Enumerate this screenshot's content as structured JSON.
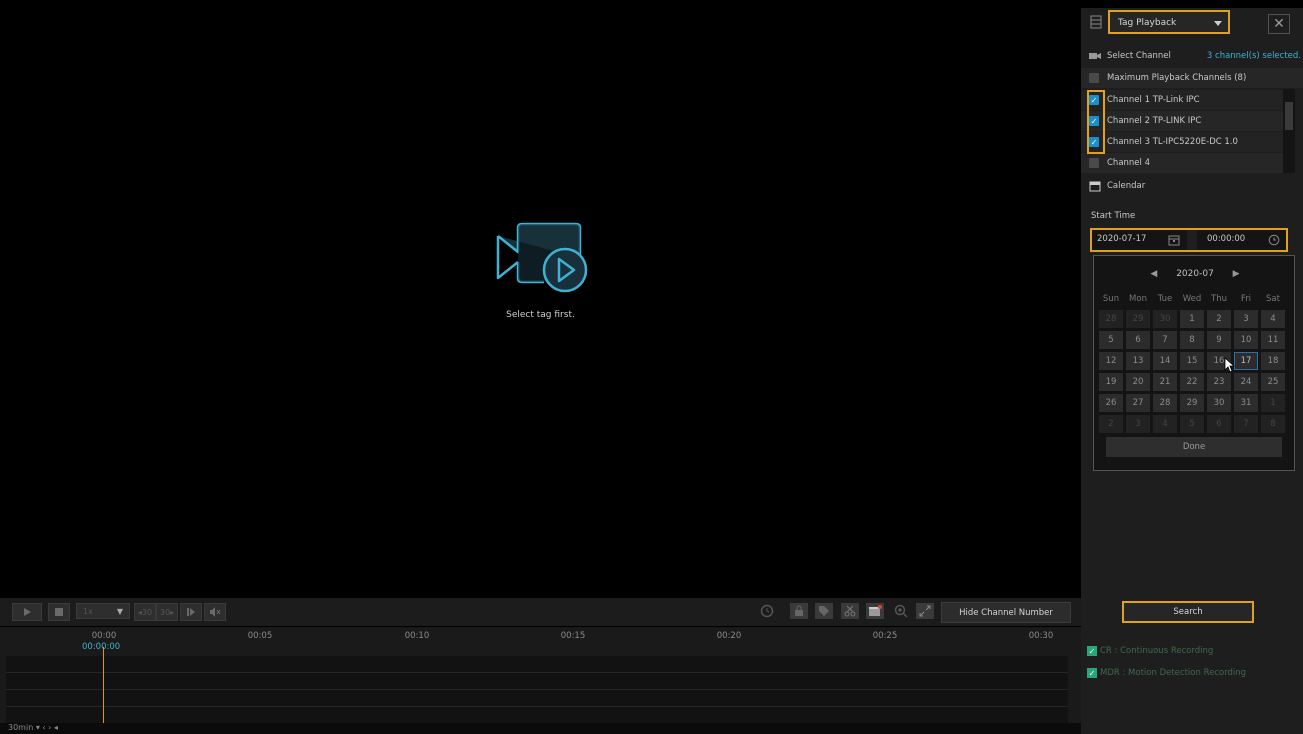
{
  "video": {
    "message": "Select tag first."
  },
  "toolbar": {
    "speed": "1x",
    "rewind": "◂30",
    "forward": "30▸",
    "hide_channel_label": "Hide Channel Number"
  },
  "timeline": {
    "ticks": [
      "00:00",
      "00:05",
      "00:10",
      "00:15",
      "00:20",
      "00:25",
      "00:30"
    ],
    "cursor_time": "00:00:00",
    "zoom": "30min"
  },
  "panel": {
    "mode": "Tag Playback",
    "select_channel_label": "Select Channel",
    "selected_summary": "3 channel(s) selected.",
    "max_channels": "Maximum Playback Channels (8)",
    "channels": [
      {
        "label": "Channel 1 TP-Link IPC",
        "checked": true
      },
      {
        "label": "Channel 2 TP-LINK IPC",
        "checked": true
      },
      {
        "label": "Channel 3 TL-IPC5220E-DC 1.0",
        "checked": true
      },
      {
        "label": "Channel 4",
        "checked": false
      }
    ],
    "calendar_label": "Calendar",
    "start_time_label": "Start Time",
    "date": "2020-07-17",
    "time": "00:00:00",
    "search_label": "Search",
    "legend": [
      {
        "label": "CR : Continuous Recording",
        "color": "#27a87a"
      },
      {
        "label": "MDR : Motion Detection Recording",
        "color": "#27a87a"
      }
    ]
  },
  "calendar": {
    "month": "2020-07",
    "weekdays": [
      "Sun",
      "Mon",
      "Tue",
      "Wed",
      "Thu",
      "Fri",
      "Sat"
    ],
    "weeks": [
      [
        "28",
        "29",
        "30",
        "1",
        "2",
        "3",
        "4"
      ],
      [
        "5",
        "6",
        "7",
        "8",
        "9",
        "10",
        "11"
      ],
      [
        "12",
        "13",
        "14",
        "15",
        "16",
        "17",
        "18"
      ],
      [
        "19",
        "20",
        "21",
        "22",
        "23",
        "24",
        "25"
      ],
      [
        "26",
        "27",
        "28",
        "29",
        "30",
        "31",
        "1"
      ],
      [
        "2",
        "3",
        "4",
        "5",
        "6",
        "7",
        "8"
      ]
    ],
    "selected": "17",
    "done_label": "Done"
  },
  "colors": {
    "accent": "#e0a21b",
    "cyan": "#3fb2d2",
    "check": "#1b8fc9"
  }
}
